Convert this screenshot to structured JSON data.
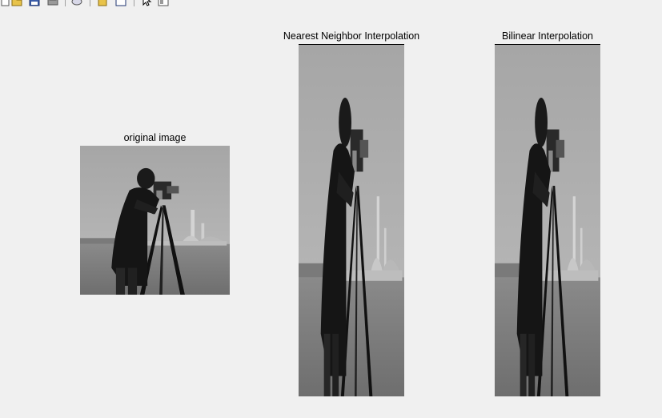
{
  "toolbar": {
    "buttons": [
      "new-figure-icon",
      "open-file-icon",
      "save-figure-icon",
      "print-figure-icon",
      "link-plot-icon",
      "insert-colorbar-icon",
      "insert-legend-icon",
      "edit-plot-icon",
      "property-inspector-icon"
    ]
  },
  "figure": {
    "panels": [
      {
        "title": "original image"
      },
      {
        "title": "Nearest Neighbor Interpolation"
      },
      {
        "title": "Bilinear Interpolation"
      }
    ]
  }
}
